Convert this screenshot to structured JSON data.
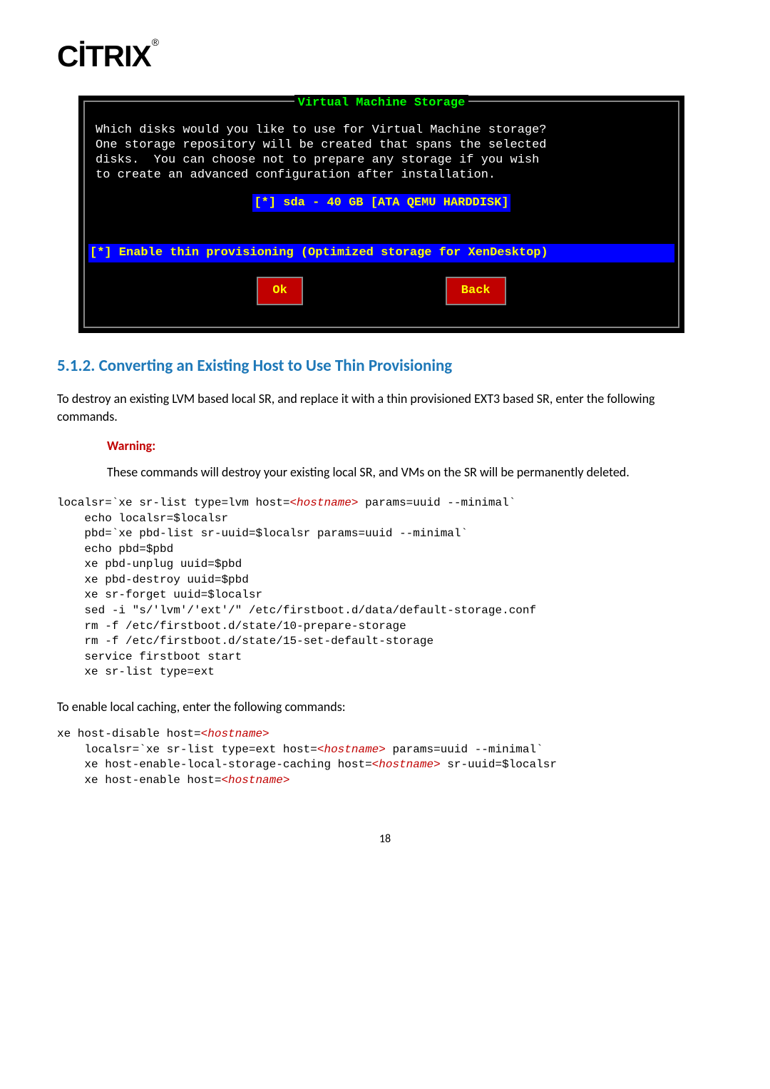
{
  "logo": {
    "text": "CİTRIX",
    "suffix": "®"
  },
  "terminal": {
    "title": "Virtual Machine Storage",
    "description": "Which disks would you like to use for Virtual Machine storage?\nOne storage repository will be created that spans the selected\ndisks.  You can choose not to prepare any storage if you wish\nto create an advanced configuration after installation.",
    "disk_option": "[*] sda - 40 GB [ATA QEMU HARDDISK]",
    "thin_option": "[*] Enable thin provisioning (Optimized storage for XenDesktop)",
    "button_ok": "Ok",
    "button_back": "Back"
  },
  "section": {
    "heading": "5.1.2. Converting an Existing Host to Use Thin Provisioning",
    "intro": "To destroy an existing LVM based local SR, and replace it with a thin provisioned EXT3 based SR, enter the following commands."
  },
  "warning": {
    "title": "Warning:",
    "text": "These commands will destroy your existing local SR, and VMs on the SR will be permanently deleted."
  },
  "code1": {
    "line1_pre": "localsr=`xe sr-list type=lvm host=",
    "line1_var": "<hostname>",
    "line1_post": " params=uuid --minimal`",
    "line2": "    echo localsr=$localsr",
    "line3": "    pbd=`xe pbd-list sr-uuid=$localsr params=uuid --minimal`",
    "line4": "    echo pbd=$pbd",
    "line5": "    xe pbd-unplug uuid=$pbd",
    "line6": "    xe pbd-destroy uuid=$pbd",
    "line7": "    xe sr-forget uuid=$localsr",
    "line8": "    sed -i \"s/'lvm'/'ext'/\" /etc/firstboot.d/data/default-storage.conf",
    "line9": "    rm -f /etc/firstboot.d/state/10-prepare-storage",
    "line10": "    rm -f /etc/firstboot.d/state/15-set-default-storage",
    "line11": "    service firstboot start",
    "line12": "    xe sr-list type=ext"
  },
  "caching_text": "To enable local caching, enter the following commands:",
  "code2": {
    "line1_pre": "xe host-disable host=",
    "line1_var": "<hostname>",
    "line2_pre": "    localsr=`xe sr-list type=ext host=",
    "line2_var": "<hostname>",
    "line2_post": " params=uuid --minimal`",
    "line3_pre": "    xe host-enable-local-storage-caching host=",
    "line3_var": "<hostname>",
    "line3_post": " sr-uuid=$localsr",
    "line4_pre": "    xe host-enable host=",
    "line4_var": "<hostname>"
  },
  "page_number": "18"
}
